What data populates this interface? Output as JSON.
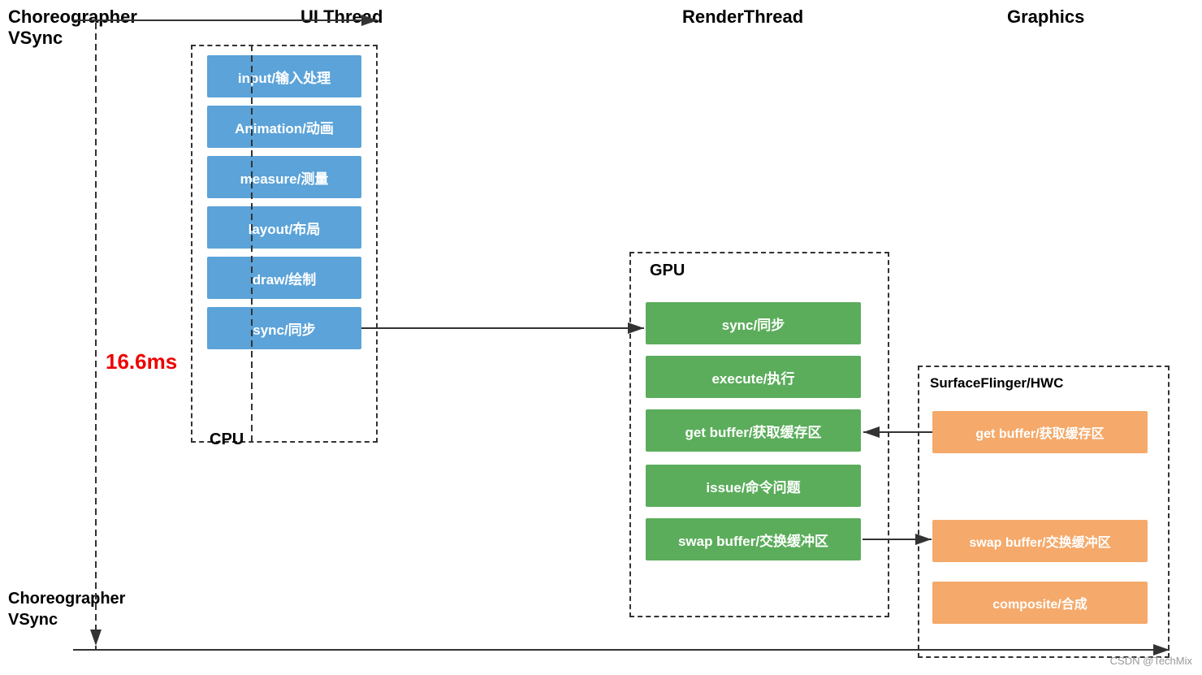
{
  "headers": {
    "choreographer": "Choreographer",
    "vsync": "VSync",
    "ui_thread": "UI Thread",
    "render_thread": "RenderThread",
    "graphics": "Graphics"
  },
  "labels": {
    "cpu": "CPU",
    "gpu": "GPU",
    "sf_hwc": "SurfaceFlinger/HWC",
    "timing": "16.6ms"
  },
  "cpu_blocks": [
    "input/输入处理",
    "Animation/动画",
    "measure/测量",
    "layout/布局",
    "draw/绘制",
    "sync/同步"
  ],
  "gpu_blocks": [
    "sync/同步",
    "execute/执行",
    "get buffer/获取缓存区",
    "issue/命令问题",
    "swap buffer/交换缓冲区"
  ],
  "sf_blocks": [
    "get buffer/获取缓存区",
    "swap buffer/交换缓冲区",
    "composite/合成"
  ],
  "watermark": "CSDN @TechMix"
}
